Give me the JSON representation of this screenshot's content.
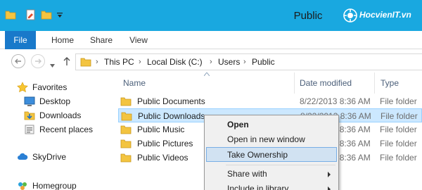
{
  "window": {
    "title": "Public",
    "watermark_text": "HocvienIT.vn"
  },
  "ribbon": {
    "tabs": [
      "File",
      "Home",
      "Share",
      "View"
    ]
  },
  "address": {
    "crumbs": [
      "This PC",
      "Local Disk (C:)",
      "Users",
      "Public"
    ]
  },
  "nav_pane": {
    "favorites": "Favorites",
    "items": [
      "Desktop",
      "Downloads",
      "Recent places"
    ],
    "skydrive": "SkyDrive",
    "homegroup": "Homegroup"
  },
  "file_list": {
    "columns": [
      "Name",
      "Date modified",
      "Type"
    ],
    "rows": [
      {
        "name": "Public Documents",
        "date": "8/22/2013 8:36 AM",
        "type": "File folder"
      },
      {
        "name": "Public Downloads",
        "date": "8/22/2013 8:36 AM",
        "type": "File folder"
      },
      {
        "name": "Public Music",
        "date": "8/22/2013 8:36 AM",
        "type": "File folder"
      },
      {
        "name": "Public Pictures",
        "date": "8/22/2013 8:36 AM",
        "type": "File folder"
      },
      {
        "name": "Public Videos",
        "date": "8/22/2013 8:36 AM",
        "type": "File folder"
      }
    ],
    "selected_row": "Public Downloads"
  },
  "context_menu": {
    "items": [
      "Open",
      "Open in new window",
      "Take Ownership",
      "Share with",
      "Include in library"
    ],
    "default_item": "Open",
    "highlighted_item": "Take Ownership"
  },
  "colors": {
    "title_bar": "#19a8e0",
    "file_tab": "#1979ca",
    "selection": "#cce8ff",
    "menu_highlight": "#d1e2f2"
  }
}
